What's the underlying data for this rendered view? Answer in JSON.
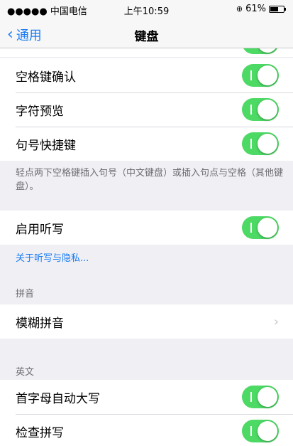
{
  "status_bar": {
    "carrier": "●●●●● 中国电信",
    "time": "上午10:59",
    "battery": "61%",
    "battery_level": 0.61
  },
  "nav": {
    "back_label": "通用",
    "title": "键盘"
  },
  "toggle_group_1": {
    "items": [
      {
        "label": "空格键确认",
        "on": true
      },
      {
        "label": "字符预览",
        "on": true
      },
      {
        "label": "句号快捷键",
        "on": true
      }
    ],
    "footer": "轻点两下空格键插入句号（中文键盘）或插入句点与空格（其他键盘）。"
  },
  "dictation": {
    "label": "启用听写",
    "on": true,
    "privacy_link": "关于听写与隐私..."
  },
  "pinyin_section": {
    "header": "拼音",
    "items": [
      {
        "label": "模糊拼音"
      }
    ]
  },
  "english_section": {
    "header": "英文",
    "items": [
      {
        "label": "首字母自动大写",
        "on": true
      },
      {
        "label": "检查拼写",
        "on": true
      }
    ]
  }
}
